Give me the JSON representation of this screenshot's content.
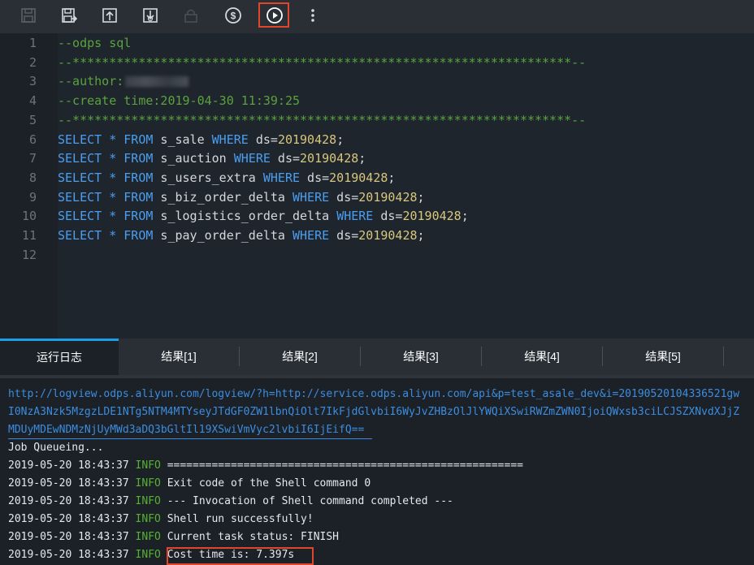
{
  "toolbar": {
    "icons": [
      "save-icon",
      "save-as-icon",
      "upload-icon",
      "download-icon",
      "lock-icon",
      "cost-icon",
      "run-icon",
      "more-icon"
    ]
  },
  "editor": {
    "lines": [
      {
        "n": "1",
        "segments": [
          {
            "t": "--odps sql",
            "c": "cm"
          }
        ]
      },
      {
        "n": "2",
        "segments": [
          {
            "t": "--********************************************************************--",
            "c": "cm"
          }
        ]
      },
      {
        "n": "3",
        "segments": [
          {
            "t": "--author:",
            "c": "cm"
          }
        ],
        "redacted": true
      },
      {
        "n": "4",
        "segments": [
          {
            "t": "--create time:2019-04-30 11:39:25",
            "c": "cm"
          }
        ]
      },
      {
        "n": "5",
        "segments": [
          {
            "t": "--********************************************************************--",
            "c": "cm"
          }
        ]
      },
      {
        "n": "6",
        "segments": [
          {
            "t": "SELECT",
            "c": "kw"
          },
          {
            "t": " ",
            "c": ""
          },
          {
            "t": "*",
            "c": "star"
          },
          {
            "t": " ",
            "c": ""
          },
          {
            "t": "FROM",
            "c": "kw"
          },
          {
            "t": " s_sale ",
            "c": ""
          },
          {
            "t": "WHERE",
            "c": "kw"
          },
          {
            "t": " ds=",
            "c": ""
          },
          {
            "t": "20190428",
            "c": "num"
          },
          {
            "t": ";",
            "c": ""
          }
        ]
      },
      {
        "n": "7",
        "segments": [
          {
            "t": "SELECT",
            "c": "kw"
          },
          {
            "t": " ",
            "c": ""
          },
          {
            "t": "*",
            "c": "star"
          },
          {
            "t": " ",
            "c": ""
          },
          {
            "t": "FROM",
            "c": "kw"
          },
          {
            "t": " s_auction ",
            "c": ""
          },
          {
            "t": "WHERE",
            "c": "kw"
          },
          {
            "t": " ds=",
            "c": ""
          },
          {
            "t": "20190428",
            "c": "num"
          },
          {
            "t": ";",
            "c": ""
          }
        ]
      },
      {
        "n": "8",
        "segments": [
          {
            "t": "SELECT",
            "c": "kw"
          },
          {
            "t": " ",
            "c": ""
          },
          {
            "t": "*",
            "c": "star"
          },
          {
            "t": " ",
            "c": ""
          },
          {
            "t": "FROM",
            "c": "kw"
          },
          {
            "t": " s_users_extra ",
            "c": ""
          },
          {
            "t": "WHERE",
            "c": "kw"
          },
          {
            "t": " ds=",
            "c": ""
          },
          {
            "t": "20190428",
            "c": "num"
          },
          {
            "t": ";",
            "c": ""
          }
        ]
      },
      {
        "n": "9",
        "segments": [
          {
            "t": "SELECT",
            "c": "kw"
          },
          {
            "t": " ",
            "c": ""
          },
          {
            "t": "*",
            "c": "star"
          },
          {
            "t": " ",
            "c": ""
          },
          {
            "t": "FROM",
            "c": "kw"
          },
          {
            "t": " s_biz_order_delta ",
            "c": ""
          },
          {
            "t": "WHERE",
            "c": "kw"
          },
          {
            "t": " ds=",
            "c": ""
          },
          {
            "t": "20190428",
            "c": "num"
          },
          {
            "t": ";",
            "c": ""
          }
        ]
      },
      {
        "n": "10",
        "segments": [
          {
            "t": "SELECT",
            "c": "kw"
          },
          {
            "t": " ",
            "c": ""
          },
          {
            "t": "*",
            "c": "star"
          },
          {
            "t": " ",
            "c": ""
          },
          {
            "t": "FROM",
            "c": "kw"
          },
          {
            "t": " s_logistics_order_delta ",
            "c": ""
          },
          {
            "t": "WHERE",
            "c": "kw"
          },
          {
            "t": " ds=",
            "c": ""
          },
          {
            "t": "20190428",
            "c": "num"
          },
          {
            "t": ";",
            "c": ""
          }
        ]
      },
      {
        "n": "11",
        "segments": [
          {
            "t": "SELECT",
            "c": "kw"
          },
          {
            "t": " ",
            "c": ""
          },
          {
            "t": "*",
            "c": "star"
          },
          {
            "t": " ",
            "c": ""
          },
          {
            "t": "FROM",
            "c": "kw"
          },
          {
            "t": " s_pay_order_delta ",
            "c": ""
          },
          {
            "t": "WHERE",
            "c": "kw"
          },
          {
            "t": " ds=",
            "c": ""
          },
          {
            "t": "20190428",
            "c": "num"
          },
          {
            "t": ";",
            "c": ""
          }
        ]
      },
      {
        "n": "12",
        "segments": []
      }
    ]
  },
  "tabs": [
    {
      "label": "运行日志"
    },
    {
      "label": "结果[1]"
    },
    {
      "label": "结果[2]"
    },
    {
      "label": "结果[3]"
    },
    {
      "label": "结果[4]"
    },
    {
      "label": "结果[5]"
    }
  ],
  "log": {
    "link_lines": [
      "http://logview.odps.aliyun.com/logview/?h=http://service.odps.aliyun.com/api&p=test_asale_dev&i=20190520104336521gw",
      "I0NzA3Nzk5MzgzLDE1NTg5NTM4MTYseyJTdGF0ZW1lbnQiOlt7IkFjdGlvbiI6WyJvZHBzOlJlYWQiXSwiRWZmZWN0IjoiQWxsb3ciLCJSZXNvdXJjZ",
      "MDUyMDEwNDMzNjUyMWd3aDQ3bGltIl19XSwiVmVyc2lvbiI6IjEifQ=="
    ],
    "queue_line": "Job Queueing...",
    "entries": [
      {
        "time": "2019-05-20 18:43:37",
        "level": "INFO",
        "msg": "========================================================"
      },
      {
        "time": "2019-05-20 18:43:37",
        "level": "INFO",
        "msg": "Exit code of the Shell command 0"
      },
      {
        "time": "2019-05-20 18:43:37",
        "level": "INFO",
        "msg": "--- Invocation of Shell command completed ---"
      },
      {
        "time": "2019-05-20 18:43:37",
        "level": "INFO",
        "msg": "Shell run successfully!"
      },
      {
        "time": "2019-05-20 18:43:37",
        "level": "INFO",
        "msg": "Current task status: FINISH"
      },
      {
        "time": "2019-05-20 18:43:37",
        "level": "INFO",
        "msg": "Cost time is: 7.397s"
      }
    ]
  },
  "colors": {
    "highlight": "#e0462c",
    "keyword": "#4b9ef0",
    "comment": "#5aa33e",
    "number": "#d8c77d",
    "info": "#55b22f",
    "link": "#3b8de0",
    "active_tab": "#1e9ee8"
  }
}
